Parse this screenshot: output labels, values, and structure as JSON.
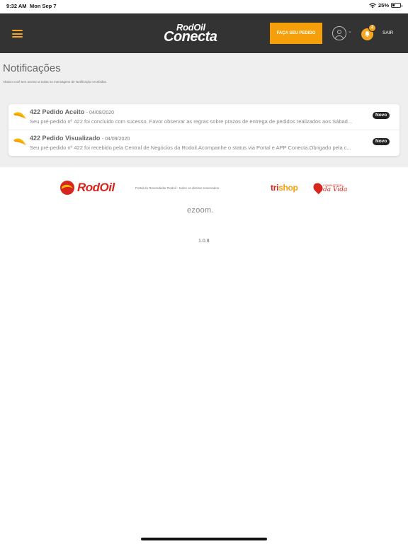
{
  "status_bar": {
    "time": "9:32 AM",
    "date": "Mon Sep 7",
    "battery": "25%",
    "battery_level": 0.25
  },
  "header": {
    "logo_line1": "RodOil",
    "logo_line2": "Conecta",
    "order_button": "FAÇA SEU PEDIDO",
    "notification_count": "2",
    "logout": "SAIR",
    "accent_color": "#f5a623",
    "background_color": "#333333"
  },
  "page": {
    "title": "Notificações",
    "subtitle": "Abaixo você tem acesso a todas as mensagens de Notificação recebidas."
  },
  "notifications": [
    {
      "title": "422 Pedido Aceito",
      "date": "- 04/09/2020",
      "body": "Seu pré-pedido nº 422 foi concluido com sucesso. Favor observar as regras sobre prazos de entrega de pedidos realizados aos Sábad...",
      "badge": "Novo"
    },
    {
      "title": "422 Pedido Visualizado",
      "date": "- 04/09/2020",
      "body": "Seu pré-pedido nº 422 foi recebido pela Central de Negócios da Rodoil.Acompanhe o status via Portal e APP Conecta.Obrigado pela c...",
      "badge": "Novo"
    }
  ],
  "footer": {
    "brand": "RodOil",
    "copyright": "Portal do Revendedor Rodoil - todos os direitos reservados",
    "trishop_tri": "tri",
    "trishop_shop": "shop",
    "combustivel_small": "COMBUSTÍVEL",
    "combustivel_big": "da Vida",
    "ezoom": "ezoom.",
    "version": "1.0.8"
  }
}
